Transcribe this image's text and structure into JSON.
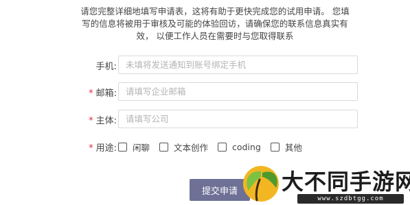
{
  "intro": {
    "line1": "请您完整详细地填写申请表，这将有助于更快完成您的试用申请。 您填",
    "line2": "写的信息将被用于审核及可能的体验回访，请确保您的联系信息真实有",
    "line3": "效， 以便工作人员在需要时与您取得联系"
  },
  "form": {
    "phone": {
      "label": "手机:",
      "value": "",
      "placeholder": "未填将发送通知到账号绑定手机"
    },
    "email": {
      "required_mark": "*",
      "label": "邮箱:",
      "value": "",
      "placeholder": "请填写企业邮箱"
    },
    "company": {
      "required_mark": "*",
      "label": "主体:",
      "value": "",
      "placeholder": "请填写公司"
    },
    "usage": {
      "required_mark": "*",
      "label": "用途:",
      "options": [
        {
          "label": "闲聊",
          "checked": false
        },
        {
          "label": "文本创作",
          "checked": false
        },
        {
          "label": "coding",
          "checked": false
        },
        {
          "label": "其他",
          "checked": false
        }
      ]
    },
    "submit_label": "提交申请"
  },
  "watermark": {
    "text": "大不同手游网",
    "url": "www.szdbtgg.com"
  },
  "colors": {
    "required": "#e0293b",
    "button": "#6e7195",
    "input_border": "#d9d9d9"
  }
}
